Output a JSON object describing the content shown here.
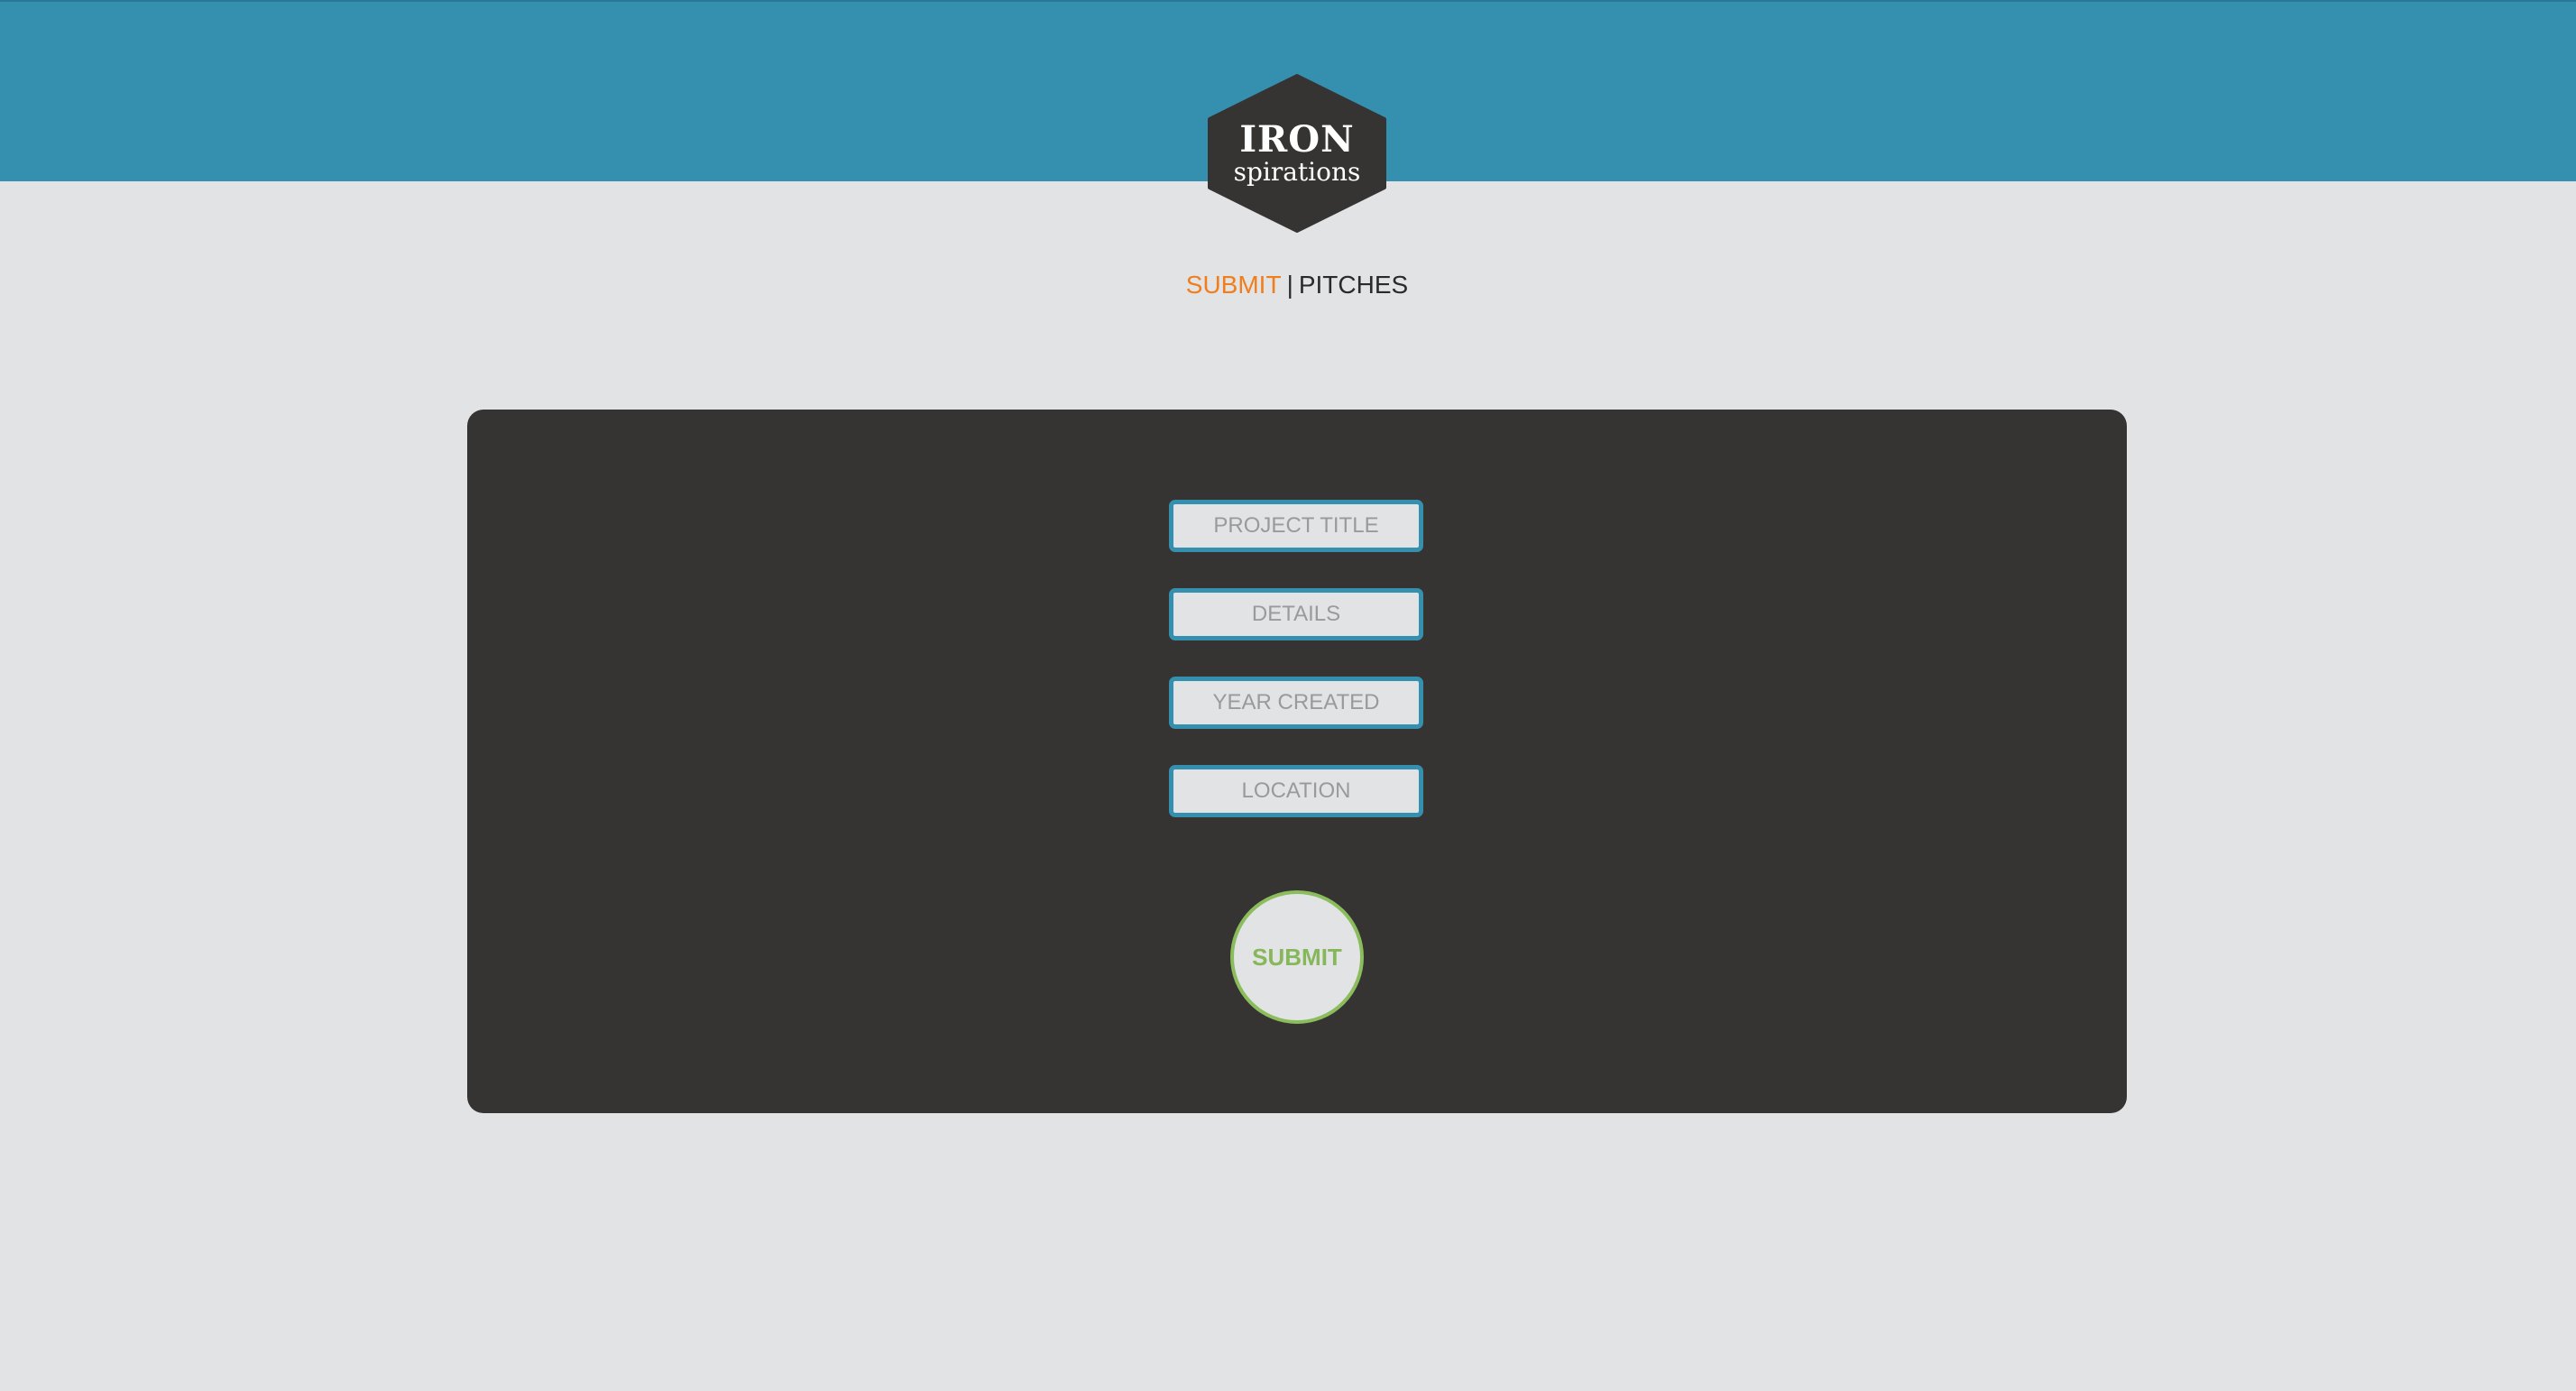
{
  "logo": {
    "line1": "IRON",
    "line2": "spirations",
    "icon": "hexagon-logo-icon"
  },
  "nav": {
    "submit_label": "SUBMIT",
    "separator": "|",
    "pitches_label": "PITCHES"
  },
  "form": {
    "fields": [
      {
        "placeholder": "PROJECT TITLE"
      },
      {
        "placeholder": "DETAILS"
      },
      {
        "placeholder": "YEAR CREATED"
      },
      {
        "placeholder": "LOCATION"
      }
    ],
    "submit_label": "SUBMIT"
  },
  "colors": {
    "header": "#3590b0",
    "background": "#e2e3e5",
    "panel": "#363432",
    "nav_active": "#f07e1c",
    "submit_accent": "#8bbd5c",
    "field_border": "#3590b0"
  }
}
